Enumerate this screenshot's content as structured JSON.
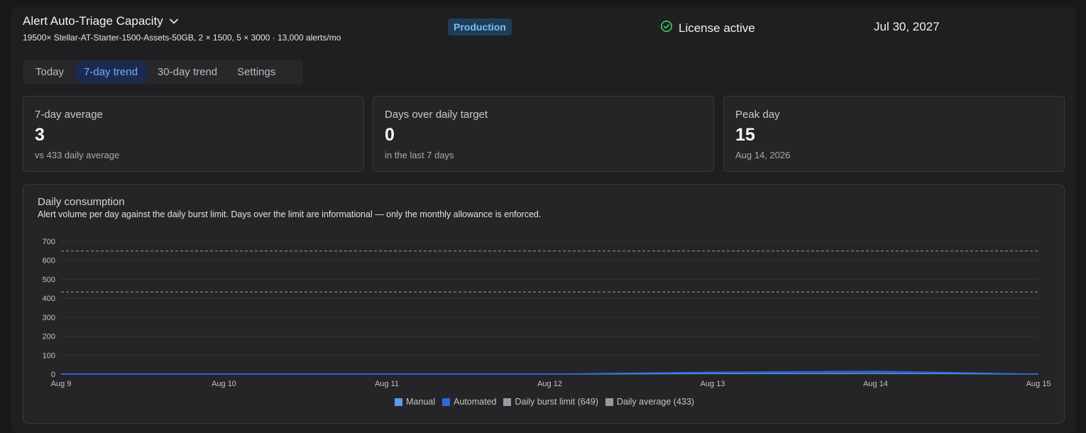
{
  "header": {
    "title": "Alert Auto-Triage Capacity",
    "subtitle": "19500× Stellar-AT-Starter-1500-Assets-50GB, 2 × 1500, 5 × 3000 · 13,000 alerts/mo",
    "environment": "Production",
    "license_status": "License active",
    "date": "Jul 30, 2027"
  },
  "tabs": [
    {
      "label": "Today",
      "active": false
    },
    {
      "label": "7-day trend",
      "active": true
    },
    {
      "label": "30-day trend",
      "active": false
    },
    {
      "label": "Settings",
      "active": false
    }
  ],
  "stats": [
    {
      "label": "7-day average",
      "value": "3",
      "sub": "vs 433 daily average"
    },
    {
      "label": "Days over daily target",
      "value": "0",
      "sub": "in the last 7 days"
    },
    {
      "label": "Peak day",
      "value": "15",
      "sub": "Aug 14, 2026"
    }
  ],
  "chart_panel": {
    "title": "Daily consumption",
    "description": "Alert volume per day against the daily burst limit. Days over the limit are informational — only the monthly allowance is enforced."
  },
  "chart_data": {
    "type": "area",
    "x": [
      "Aug 9",
      "Aug 10",
      "Aug 11",
      "Aug 12",
      "Aug 13",
      "Aug 14",
      "Aug 15"
    ],
    "yticks": [
      0,
      100,
      200,
      300,
      400,
      500,
      600,
      700
    ],
    "ylim": [
      0,
      700
    ],
    "series": [
      {
        "name": "Manual",
        "color": "#5a9bea",
        "values": [
          0,
          0,
          0,
          0,
          3,
          5,
          0
        ]
      },
      {
        "name": "Automated",
        "color": "#2f66e0",
        "values": [
          0,
          0,
          0,
          0,
          7,
          10,
          0
        ]
      }
    ],
    "reference_lines": [
      {
        "name": "Daily burst limit (649)",
        "value": 649,
        "color": "#9a9a9e"
      },
      {
        "name": "Daily average (433)",
        "value": 433,
        "color": "#9a9a9e"
      }
    ],
    "grid": true,
    "legend_position": "bottom-center"
  },
  "colors": {
    "accent": "#6fb1ff",
    "success": "#3ecf6a",
    "badge_bg": "#203d57"
  }
}
